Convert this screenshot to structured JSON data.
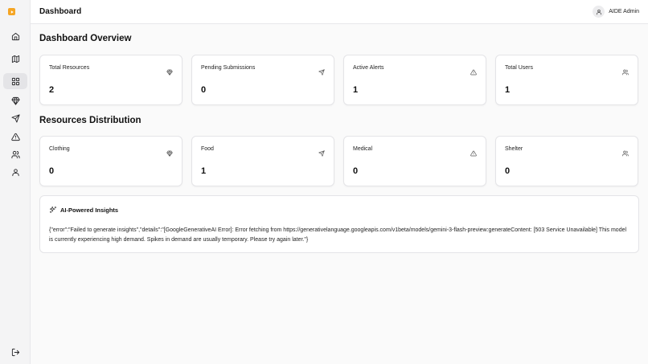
{
  "app": {
    "logo_icon": "play-icon",
    "accent": "#f5a524"
  },
  "header": {
    "title": "Dashboard",
    "user_name": "AIDE Admin"
  },
  "sidebar": {
    "items": [
      {
        "icon": "home-icon"
      },
      {
        "icon": "map-icon"
      },
      {
        "icon": "dashboard-grid-icon",
        "active": true
      },
      {
        "icon": "gem-icon"
      },
      {
        "icon": "send-icon"
      },
      {
        "icon": "alert-triangle-icon"
      },
      {
        "icon": "users-icon"
      },
      {
        "icon": "user-icon"
      }
    ],
    "logout_icon": "logout-icon"
  },
  "overview": {
    "title": "Dashboard Overview",
    "cards": [
      {
        "label": "Total Resources",
        "value": "2",
        "icon": "gem-icon"
      },
      {
        "label": "Pending Submissions",
        "value": "0",
        "icon": "send-icon"
      },
      {
        "label": "Active Alerts",
        "value": "1",
        "icon": "alert-triangle-icon"
      },
      {
        "label": "Total Users",
        "value": "1",
        "icon": "users-icon"
      }
    ]
  },
  "distribution": {
    "title": "Resources Distribution",
    "cards": [
      {
        "label": "Clothing",
        "value": "0",
        "icon": "gem-icon"
      },
      {
        "label": "Food",
        "value": "1",
        "icon": "send-icon"
      },
      {
        "label": "Medical",
        "value": "0",
        "icon": "alert-triangle-icon"
      },
      {
        "label": "Shelter",
        "value": "0",
        "icon": "users-icon"
      }
    ]
  },
  "insights": {
    "title": "AI-Powered Insights",
    "icon": "sparkles-icon",
    "body": "{\"error\":\"Failed to generate insights\",\"details\":\"[GoogleGenerativeAI Error]: Error fetching from https://generativelanguage.googleapis.com/v1beta/models/gemini-3-flash-preview:generateContent: [503 Service Unavailable] This model is currently experiencing high demand. Spikes in demand are usually temporary. Please try again later.\"}"
  }
}
